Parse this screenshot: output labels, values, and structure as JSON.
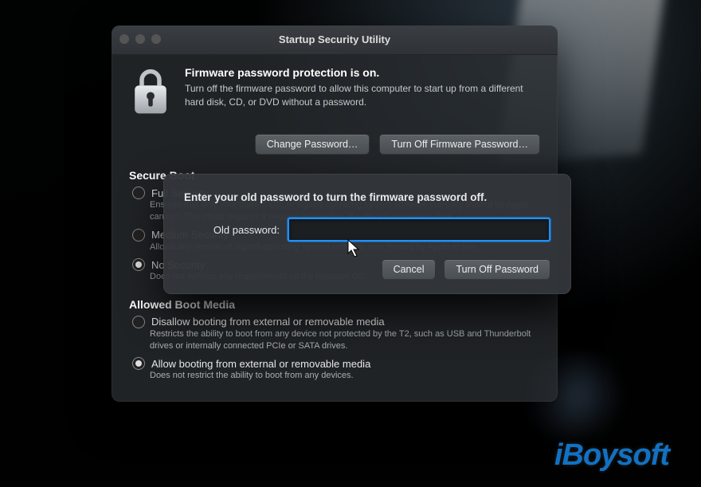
{
  "window": {
    "title": "Startup Security Utility",
    "firmware": {
      "heading": "Firmware password protection is on.",
      "description": "Turn off the firmware password to allow this computer to start up from a different hard disk, CD, or DVD without a password.",
      "change_btn": "Change Password…",
      "turnoff_btn": "Turn Off Firmware Password…"
    },
    "secure_boot": {
      "heading": "Secure Boot",
      "options": [
        {
          "label": "Full Security",
          "selected": false,
          "desc": "Ensures that only your current OS, or signed operating system software currently trusted by Apple, can run. This mode requires a network connection at software installation time."
        },
        {
          "label": "Medium Security",
          "selected": false,
          "desc": "Allows any version of signed operating system software ever trusted by Apple to run."
        },
        {
          "label": "No Security",
          "selected": true,
          "desc": "Does not enforce any requirements on the bootable OS."
        }
      ]
    },
    "boot_media": {
      "heading": "Allowed Boot Media",
      "options": [
        {
          "label": "Disallow booting from external or removable media",
          "selected": false,
          "desc": "Restricts the ability to boot from any device not protected by the T2, such as USB and Thunderbolt drives or internally connected PCIe or SATA drives."
        },
        {
          "label": "Allow booting from external or removable media",
          "selected": true,
          "desc": "Does not restrict the ability to boot from any devices."
        }
      ]
    }
  },
  "sheet": {
    "prompt": "Enter your old password to turn the firmware password off.",
    "field_label": "Old password:",
    "input_value": "",
    "cancel": "Cancel",
    "confirm": "Turn Off Password"
  },
  "watermark": "iBoysoft"
}
